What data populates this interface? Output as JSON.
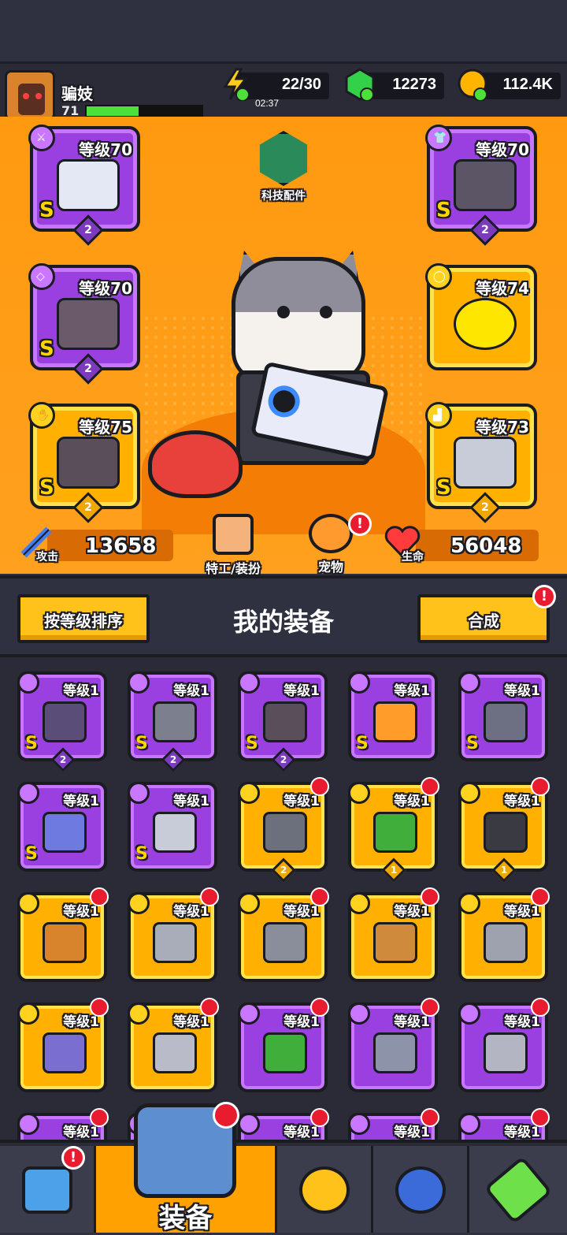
{
  "player": {
    "name": "骗妓",
    "level": "71",
    "xp_fraction": 0.45
  },
  "resources": {
    "energy": "22/30",
    "energy_timer": "02:37",
    "gems": "12273",
    "coins": "112.4K"
  },
  "hero": {
    "tech_label": "科技配件",
    "slots": [
      {
        "level": "等级70",
        "rank": "S",
        "stars": "2",
        "color": "purple"
      },
      {
        "level": "等级70",
        "rank": "S",
        "stars": "2",
        "color": "purple"
      },
      {
        "level": "等级70",
        "rank": "S",
        "stars": "2",
        "color": "purple"
      },
      {
        "level": "等级74",
        "rank": "",
        "stars": "",
        "color": "gold"
      },
      {
        "level": "等级75",
        "rank": "S",
        "stars": "2",
        "color": "gold"
      },
      {
        "level": "等级73",
        "rank": "S",
        "stars": "2",
        "color": "gold"
      }
    ],
    "attack_label": "攻击",
    "attack_value": "13658",
    "agent_label": "特工/装扮",
    "pet_label": "宠物",
    "life_label": "生命",
    "life_value": "56048",
    "pet_badge": "!"
  },
  "equipment": {
    "sort_button": "按等级排序",
    "title": "我的装备",
    "merge_button": "合成",
    "merge_badge": "!",
    "items": [
      {
        "level": "等级1",
        "rank": "S",
        "count": "2",
        "color": "purple"
      },
      {
        "level": "等级1",
        "rank": "S",
        "count": "2",
        "color": "purple"
      },
      {
        "level": "等级1",
        "rank": "S",
        "count": "2",
        "color": "purple"
      },
      {
        "level": "等级1",
        "rank": "S",
        "count": "",
        "color": "purple"
      },
      {
        "level": "等级1",
        "rank": "S",
        "count": "",
        "color": "purple"
      },
      {
        "level": "等级1",
        "rank": "S",
        "count": "",
        "color": "purple"
      },
      {
        "level": "等级1",
        "rank": "S",
        "count": "",
        "color": "purple"
      },
      {
        "level": "等级1",
        "rank": "",
        "count": "2",
        "color": "gold"
      },
      {
        "level": "等级1",
        "rank": "",
        "count": "1",
        "color": "gold"
      },
      {
        "level": "等级1",
        "rank": "",
        "count": "1",
        "color": "gold"
      },
      {
        "level": "等级1",
        "rank": "",
        "count": "",
        "color": "gold"
      },
      {
        "level": "等级1",
        "rank": "",
        "count": "",
        "color": "gold"
      },
      {
        "level": "等级1",
        "rank": "",
        "count": "",
        "color": "gold"
      },
      {
        "level": "等级1",
        "rank": "",
        "count": "",
        "color": "gold"
      },
      {
        "level": "等级1",
        "rank": "",
        "count": "",
        "color": "gold"
      },
      {
        "level": "等级1",
        "rank": "",
        "count": "",
        "color": "gold"
      },
      {
        "level": "等级1",
        "rank": "",
        "count": "",
        "color": "gold"
      },
      {
        "level": "等级1",
        "rank": "",
        "count": "",
        "color": "purple"
      },
      {
        "level": "等级1",
        "rank": "",
        "count": "",
        "color": "purple"
      },
      {
        "level": "等级1",
        "rank": "",
        "count": "",
        "color": "purple"
      },
      {
        "level": "等级1",
        "rank": "",
        "count": "",
        "color": "purple"
      },
      {
        "level": "等级1",
        "rank": "",
        "count": "",
        "color": "purple"
      },
      {
        "level": "等级1",
        "rank": "",
        "count": "",
        "color": "purple"
      },
      {
        "level": "等级1",
        "rank": "",
        "count": "",
        "color": "purple"
      },
      {
        "level": "等级1",
        "rank": "",
        "count": "",
        "color": "purple"
      }
    ]
  },
  "nav": {
    "equip_label": "装备",
    "shop_badge": "!",
    "tabs": [
      "shop-icon",
      "equipment-icon",
      "star-weapons-icon",
      "stars-orb-icon",
      "dna-tube-icon"
    ]
  },
  "colors": {
    "hero_bg": "#ff9a10",
    "purple": "#9a3fe0",
    "gold": "#ffb000",
    "accent_red": "#e81c2e"
  }
}
